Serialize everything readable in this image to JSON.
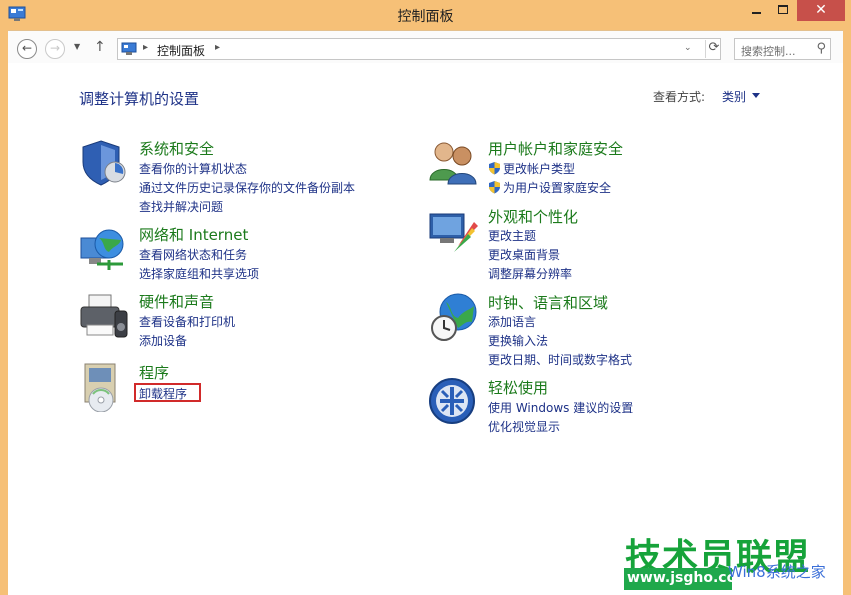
{
  "window": {
    "title": "控制面板",
    "close_glyph": "✕"
  },
  "nav": {
    "back_glyph": "←",
    "forward_glyph": "→",
    "recent_glyph": "▼",
    "up_glyph": "↑",
    "address": "控制面板",
    "address_sep1": "▸",
    "address_sep2": "▸",
    "address_drop": "⌄",
    "refresh_glyph": "⟳",
    "search_placeholder": "搜索控制...",
    "search_glyph": "⚲"
  },
  "content": {
    "heading": "调整计算机的设置",
    "view_by_label": "查看方式:",
    "view_by_value": "类别"
  },
  "categories_left": [
    {
      "title": "系统和安全",
      "icon": "system-security-icon",
      "links": [
        "查看你的计算机状态",
        "通过文件历史记录保存你的文件备份副本",
        "查找并解决问题"
      ]
    },
    {
      "title": "网络和 Internet",
      "icon": "network-internet-icon",
      "links": [
        "查看网络状态和任务",
        "选择家庭组和共享选项"
      ]
    },
    {
      "title": "硬件和声音",
      "icon": "hardware-sound-icon",
      "links": [
        "查看设备和打印机",
        "添加设备"
      ]
    },
    {
      "title": "程序",
      "icon": "programs-icon",
      "links": [
        "卸载程序"
      ]
    }
  ],
  "categories_right": [
    {
      "title": "用户帐户和家庭安全",
      "icon": "user-accounts-icon",
      "links": [
        "更改帐户类型",
        "为用户设置家庭安全"
      ]
    },
    {
      "title": "外观和个性化",
      "icon": "appearance-icon",
      "links": [
        "更改主题",
        "更改桌面背景",
        "调整屏幕分辨率"
      ]
    },
    {
      "title": "时钟、语言和区域",
      "icon": "clock-language-icon",
      "links": [
        "添加语言",
        "更换输入法",
        "更改日期、时间或数字格式"
      ]
    },
    {
      "title": "轻松使用",
      "icon": "ease-of-access-icon",
      "links": [
        "使用 Windows 建议的设置",
        "优化视觉显示"
      ]
    }
  ],
  "watermark": {
    "brand": "技术员联盟",
    "url": "www.jsgho.com",
    "overlay": "Win8系统之家"
  },
  "colors": {
    "frame": "#f6c077",
    "link": "#1e3287",
    "category_title": "#1b7a1b",
    "highlight": "#d12a2a"
  }
}
